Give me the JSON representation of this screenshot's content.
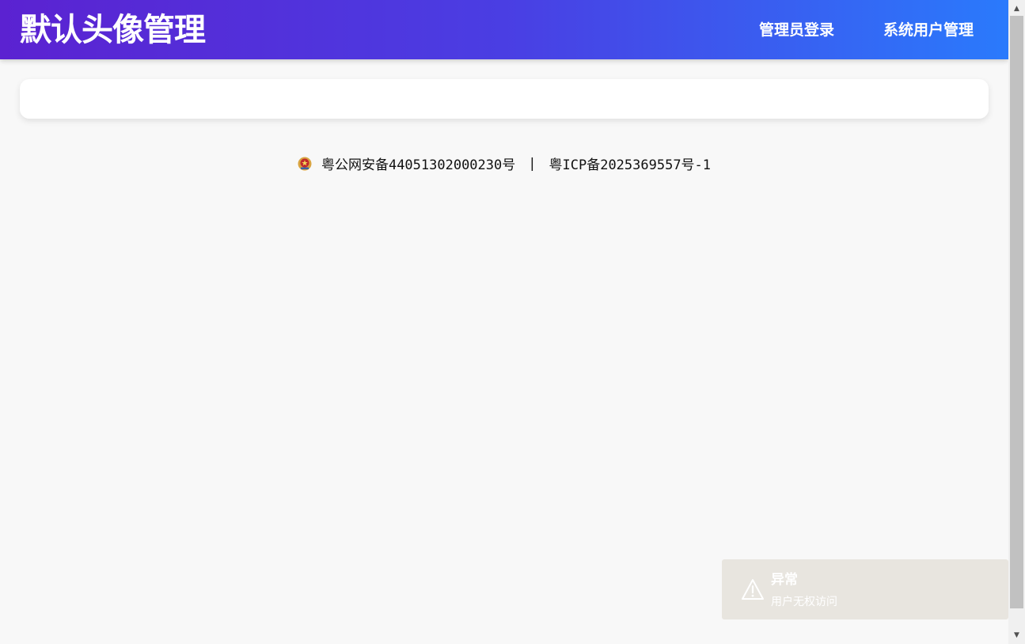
{
  "header": {
    "title": "默认头像管理",
    "nav": {
      "admin_login": "管理员登录",
      "user_management": "系统用户管理"
    }
  },
  "footer": {
    "police_record": "粤公网安备44051302000230号",
    "separator": "|",
    "icp_record": "粤ICP备2025369557号-1",
    "emblem_icon": "police-emblem-icon"
  },
  "toast": {
    "title": "异常",
    "message": "用户无权访问",
    "icon": "warning-icon"
  },
  "colors": {
    "header_gradient_start": "#5b22d1",
    "header_gradient_end": "#2a7afc",
    "toast_background": "#e8e5df"
  }
}
